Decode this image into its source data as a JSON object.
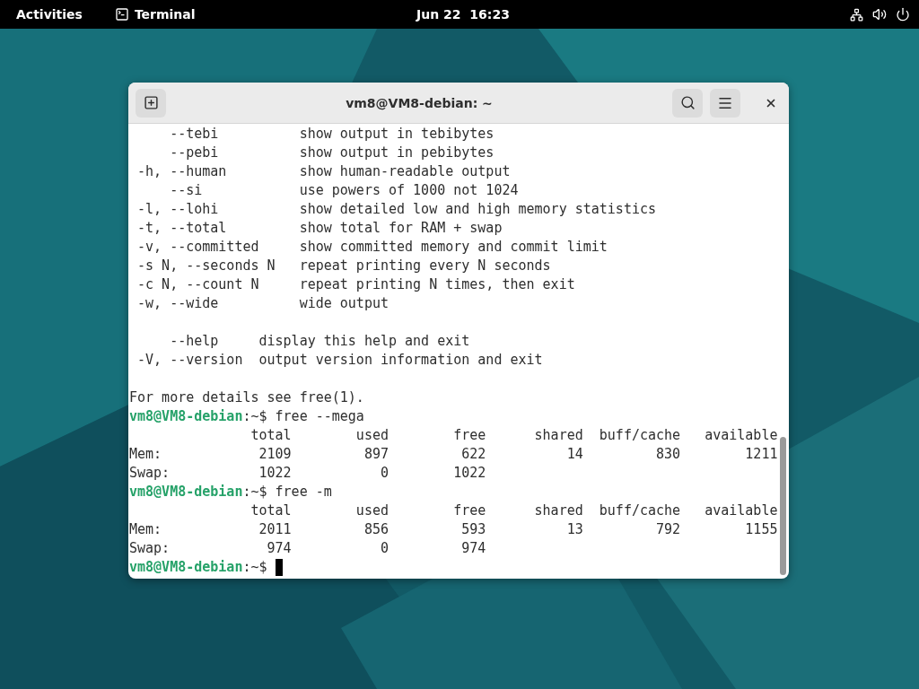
{
  "top_bar": {
    "activities": "Activities",
    "app": "Terminal",
    "clock": "Jun 22  16:23"
  },
  "window": {
    "title": "vm8@VM8-debian: ~",
    "lines": [
      {
        "kind": "output",
        "text": "     --tebi          show output in tebibytes"
      },
      {
        "kind": "output",
        "text": "     --pebi          show output in pebibytes"
      },
      {
        "kind": "output",
        "text": " -h, --human         show human-readable output"
      },
      {
        "kind": "output",
        "text": "     --si            use powers of 1000 not 1024"
      },
      {
        "kind": "output",
        "text": " -l, --lohi          show detailed low and high memory statistics"
      },
      {
        "kind": "output",
        "text": " -t, --total         show total for RAM + swap"
      },
      {
        "kind": "output",
        "text": " -v, --committed     show committed memory and commit limit"
      },
      {
        "kind": "output",
        "text": " -s N, --seconds N   repeat printing every N seconds"
      },
      {
        "kind": "output",
        "text": " -c N, --count N     repeat printing N times, then exit"
      },
      {
        "kind": "output",
        "text": " -w, --wide          wide output"
      },
      {
        "kind": "blank"
      },
      {
        "kind": "output",
        "text": "     --help     display this help and exit"
      },
      {
        "kind": "output",
        "text": " -V, --version  output version information and exit"
      },
      {
        "kind": "blank"
      },
      {
        "kind": "output",
        "text": "For more details see free(1)."
      },
      {
        "kind": "prompt",
        "prompt": "vm8@VM8-debian",
        "path": ":~$ ",
        "command": "free --mega",
        "cursor": false
      },
      {
        "kind": "output",
        "text": "               total        used        free      shared  buff/cache   available"
      },
      {
        "kind": "output",
        "text": "Mem:            2109         897         622          14         830        1211"
      },
      {
        "kind": "output",
        "text": "Swap:           1022           0        1022"
      },
      {
        "kind": "prompt",
        "prompt": "vm8@VM8-debian",
        "path": ":~$ ",
        "command": "free -m",
        "cursor": false
      },
      {
        "kind": "output",
        "text": "               total        used        free      shared  buff/cache   available"
      },
      {
        "kind": "output",
        "text": "Mem:            2011         856         593          13         792        1155"
      },
      {
        "kind": "output",
        "text": "Swap:            974           0         974"
      },
      {
        "kind": "prompt",
        "prompt": "vm8@VM8-debian",
        "path": ":~$ ",
        "cursor": true
      }
    ]
  }
}
